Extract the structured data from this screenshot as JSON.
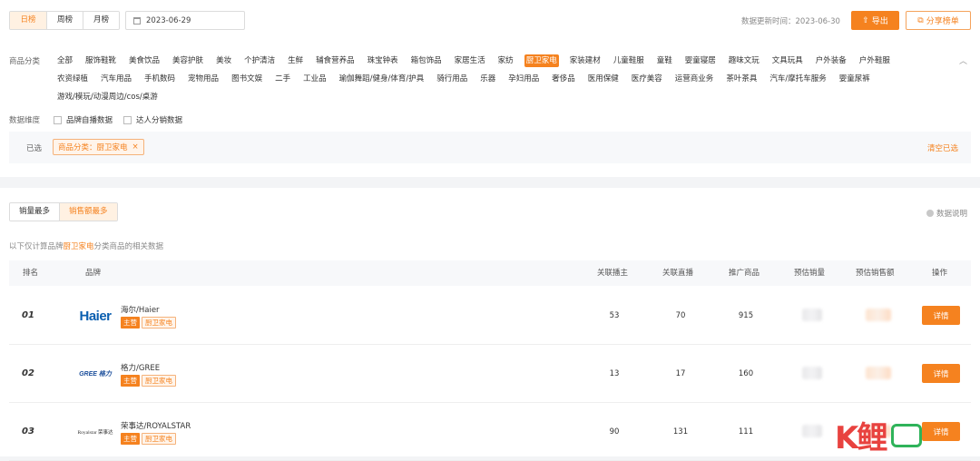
{
  "header": {
    "period_tabs": [
      {
        "label": "日榜",
        "active": true
      },
      {
        "label": "周榜",
        "active": false
      },
      {
        "label": "月榜",
        "active": false
      }
    ],
    "date_value": "2023-06-29",
    "update_label": "数据更新时间：",
    "update_value": "2023-06-30",
    "export_label": "导出",
    "share_label": "分享榜单"
  },
  "filters": {
    "category_label": "商品分类",
    "categories_row1": [
      "全部",
      "服饰鞋靴",
      "美食饮品",
      "美容护肤",
      "美妆",
      "个护清洁",
      "生鲜",
      "辅食营养品",
      "珠宝钟表",
      "箱包饰品",
      "家居生活",
      "家纺",
      "厨卫家电",
      "家装建材",
      "儿童鞋服",
      "童鞋",
      "婴童寝居",
      "趣味文玩",
      "文具玩具",
      "户外装备",
      "户外鞋服"
    ],
    "categories_row2": [
      "农资绿植",
      "汽车用品",
      "手机数码",
      "宠物用品",
      "图书文娱",
      "二手",
      "工业品",
      "瑜伽舞蹈/健身/体育/护具",
      "骑行用品",
      "乐器",
      "孕妇用品",
      "奢侈品",
      "医用保健",
      "医疗美容",
      "运营商业务",
      "茶叶茶具",
      "汽车/摩托车服务",
      "婴童尿裤"
    ],
    "categories_row3": [
      "游戏/模玩/动漫周边/cos/桌游"
    ],
    "active_category": "厨卫家电",
    "dimension_label": "数据维度",
    "dimension_options": [
      "品牌自播数据",
      "达人分销数据"
    ],
    "selected_label": "已选",
    "selected_tag": "商品分类：厨卫家电",
    "tag_close": "×",
    "clear_label": "清空已选"
  },
  "ranking": {
    "sort_tabs": [
      {
        "label": "销量最多",
        "active": false
      },
      {
        "label": "销售额最多",
        "active": true
      }
    ],
    "data_note": "数据说明",
    "note_prefix": "以下仅计算品牌",
    "note_highlight": "厨卫家电",
    "note_suffix": "分类商品的相关数据",
    "columns": {
      "rank": "排名",
      "brand": "品牌",
      "anchors": "关联播主",
      "lives": "关联直播",
      "products": "推广商品",
      "sales": "预估销量",
      "revenue": "预估销售额",
      "action": "操作"
    },
    "rows": [
      {
        "rank": "01",
        "logo": "Haier",
        "brand": "海尔/Haier",
        "badge_main": "主营",
        "badge_cat": "厨卫家电",
        "anchors": "53",
        "lives": "70",
        "products": "915",
        "action": "详情"
      },
      {
        "rank": "02",
        "logo": "GREE 格力",
        "brand": "格力/GREE",
        "badge_main": "主营",
        "badge_cat": "厨卫家电",
        "anchors": "13",
        "lives": "17",
        "products": "160",
        "action": "详情"
      },
      {
        "rank": "03",
        "logo": "Royalstar 荣事达",
        "brand": "荣事达/ROYALSTAR",
        "badge_main": "主营",
        "badge_cat": "厨卫家电",
        "anchors": "90",
        "lives": "131",
        "products": "111",
        "action": "详情"
      }
    ]
  },
  "watermark": {
    "text": "K鲤"
  },
  "colors": {
    "accent": "#f5821f",
    "tag_bg": "#fff4ea",
    "haier_blue": "#0b5fb0",
    "gree_blue": "#1b4e9b"
  }
}
